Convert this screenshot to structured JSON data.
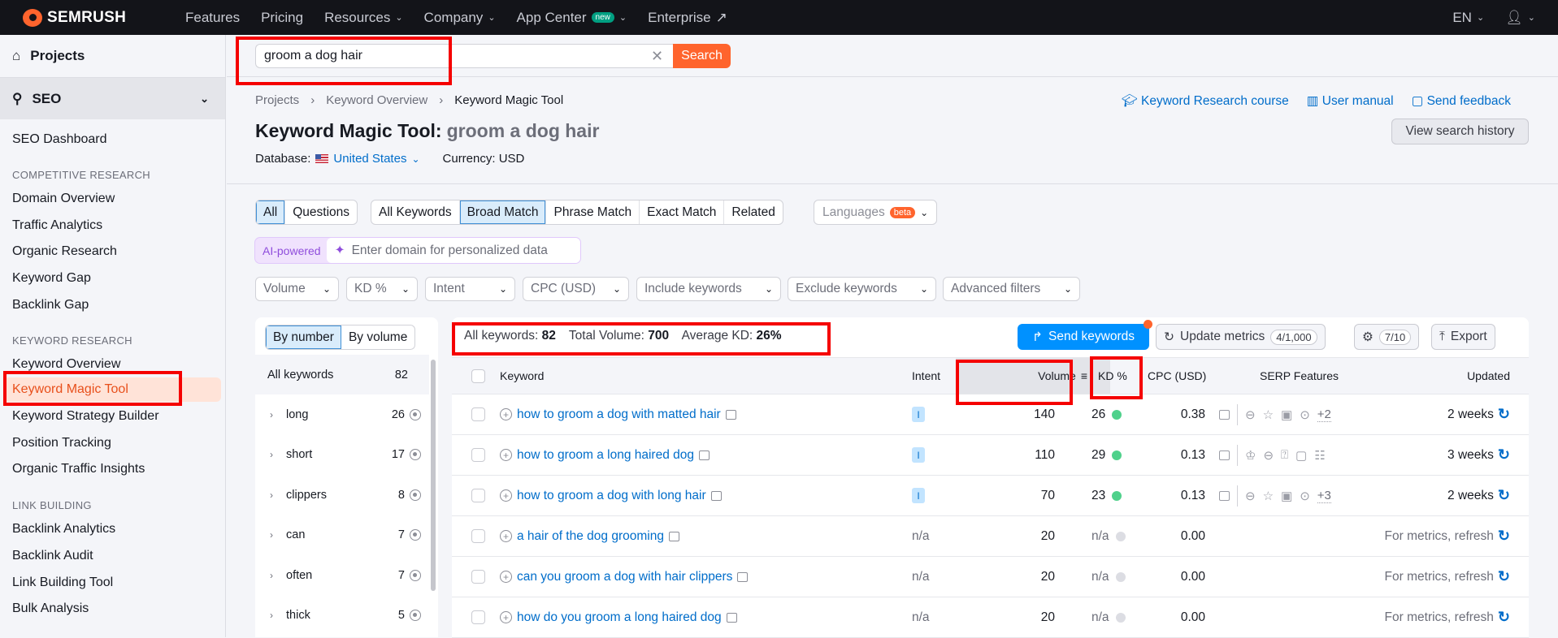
{
  "topbar": {
    "brand": "SEMRUSH",
    "nav": [
      {
        "label": "Features"
      },
      {
        "label": "Pricing"
      },
      {
        "label": "Resources"
      },
      {
        "label": "Company"
      },
      {
        "label": "App Center",
        "badge": "new"
      },
      {
        "label": "Enterprise"
      }
    ],
    "language": "EN"
  },
  "sidebar": {
    "projects": "Projects",
    "seo": "SEO",
    "dashboard": "SEO Dashboard",
    "sections": [
      {
        "title": "COMPETITIVE RESEARCH",
        "items": [
          "Domain Overview",
          "Traffic Analytics",
          "Organic Research",
          "Keyword Gap",
          "Backlink Gap"
        ]
      },
      {
        "title": "KEYWORD RESEARCH",
        "items": [
          "Keyword Overview",
          "Keyword Magic Tool",
          "Keyword Strategy Builder",
          "Position Tracking",
          "Organic Traffic Insights"
        ]
      },
      {
        "title": "LINK BUILDING",
        "items": [
          "Backlink Analytics",
          "Backlink Audit",
          "Link Building Tool",
          "Bulk Analysis"
        ]
      }
    ],
    "active": "Keyword Magic Tool"
  },
  "search": {
    "value": "groom a dog hair",
    "button": "Search"
  },
  "breadcrumb": [
    "Projects",
    "Keyword Overview",
    "Keyword Magic Tool"
  ],
  "header": {
    "title": "Keyword Magic Tool:",
    "query": "groom a dog hair",
    "database_label": "Database:",
    "database": "United States",
    "currency": "Currency: USD",
    "links": [
      "Keyword Research course",
      "User manual",
      "Send feedback"
    ],
    "history": "View search history"
  },
  "filters": {
    "type": [
      "All",
      "Questions"
    ],
    "match": [
      "All Keywords",
      "Broad Match",
      "Phrase Match",
      "Exact Match",
      "Related"
    ],
    "languages": "Languages",
    "beta": "beta",
    "ai_label": "AI-powered",
    "ai_placeholder": "Enter domain for personalized data",
    "dropdowns": [
      "Volume",
      "KD %",
      "Intent",
      "CPC (USD)",
      "Include keywords",
      "Exclude keywords",
      "Advanced filters"
    ]
  },
  "groups": {
    "toggle": [
      "By number",
      "By volume"
    ],
    "all_label": "All keywords",
    "all_count": "82",
    "items": [
      {
        "name": "long",
        "count": "26"
      },
      {
        "name": "short",
        "count": "17"
      },
      {
        "name": "clippers",
        "count": "8"
      },
      {
        "name": "can",
        "count": "7"
      },
      {
        "name": "often",
        "count": "7"
      },
      {
        "name": "thick",
        "count": "5"
      }
    ]
  },
  "stats": {
    "all_label": "All keywords:",
    "all": "82",
    "vol_label": "Total Volume:",
    "vol": "700",
    "kd_label": "Average KD:",
    "kd": "26%"
  },
  "toolbar": {
    "send": "Send keywords",
    "update": "Update metrics",
    "update_count": "4/1,000",
    "settings_count": "7/10",
    "export": "Export"
  },
  "table": {
    "headers": [
      "Keyword",
      "Intent",
      "Volume",
      "KD %",
      "CPC (USD)",
      "SERP Features",
      "Updated"
    ],
    "rows": [
      {
        "keyword": "how to groom a dog with matted hair",
        "intent": "I",
        "volume": "140",
        "kd": "26",
        "kd_color": "#4fd18b",
        "cpc": "0.38",
        "serp_more": "+2",
        "updated": "2 weeks"
      },
      {
        "keyword": "how to groom a long haired dog",
        "intent": "I",
        "volume": "110",
        "kd": "29",
        "kd_color": "#4fd18b",
        "cpc": "0.13",
        "serp_more": "",
        "updated": "3 weeks"
      },
      {
        "keyword": "how to groom a dog with long hair",
        "intent": "I",
        "volume": "70",
        "kd": "23",
        "kd_color": "#4fd18b",
        "cpc": "0.13",
        "serp_more": "+3",
        "updated": "2 weeks"
      },
      {
        "keyword": "a hair of the dog grooming",
        "intent": "n/a",
        "volume": "20",
        "kd": "n/a",
        "kd_color": "#dcdde3",
        "cpc": "0.00",
        "serp_more": "",
        "updated": "For metrics, refresh"
      },
      {
        "keyword": "can you groom a dog with hair clippers",
        "intent": "n/a",
        "volume": "20",
        "kd": "n/a",
        "kd_color": "#dcdde3",
        "cpc": "0.00",
        "serp_more": "",
        "updated": "For metrics, refresh"
      },
      {
        "keyword": "how do you groom a long haired dog",
        "intent": "n/a",
        "volume": "20",
        "kd": "n/a",
        "kd_color": "#dcdde3",
        "cpc": "0.00",
        "serp_more": "",
        "updated": "For metrics, refresh"
      }
    ]
  }
}
